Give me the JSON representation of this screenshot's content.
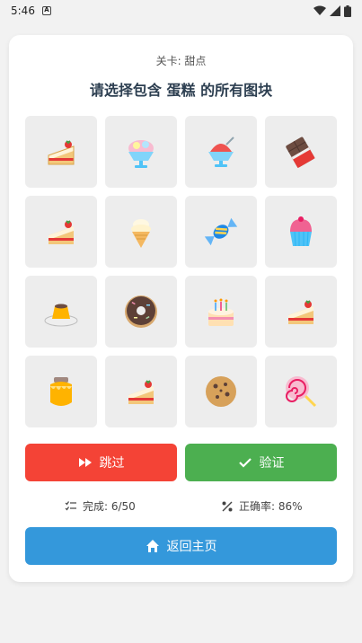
{
  "status_bar": {
    "time": "5:46",
    "badge": "A"
  },
  "game": {
    "level_label": "关卡: 甜点",
    "instruction": "请选择包含 蛋糕 的所有图块",
    "tiles": [
      {
        "icon": "strawberry-cake-icon"
      },
      {
        "icon": "ice-cream-sundae-icon"
      },
      {
        "icon": "shaved-ice-icon"
      },
      {
        "icon": "chocolate-bar-icon"
      },
      {
        "icon": "strawberry-cake-icon"
      },
      {
        "icon": "soft-ice-cream-icon"
      },
      {
        "icon": "candy-icon"
      },
      {
        "icon": "cupcake-icon"
      },
      {
        "icon": "custard-pudding-icon"
      },
      {
        "icon": "donut-icon"
      },
      {
        "icon": "birthday-cake-icon"
      },
      {
        "icon": "strawberry-cake-icon"
      },
      {
        "icon": "honey-pot-icon"
      },
      {
        "icon": "strawberry-cake-icon"
      },
      {
        "icon": "cookie-icon"
      },
      {
        "icon": "lollipop-icon"
      }
    ],
    "skip_label": "跳过",
    "verify_label": "验证",
    "progress_text": "完成: 6/50",
    "accuracy_text": "正确率: 86%",
    "home_label": "返回主页"
  },
  "colors": {
    "skip": "#f44336",
    "verify": "#4caf50",
    "home": "#3498db",
    "title": "#2c3e50"
  }
}
